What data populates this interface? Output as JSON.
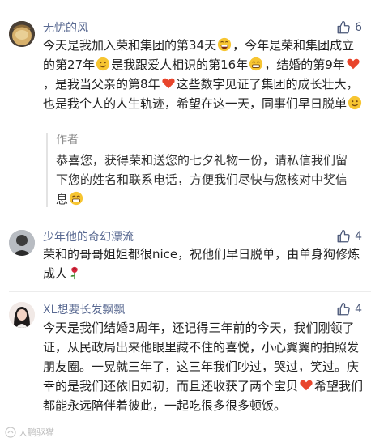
{
  "comments": [
    {
      "username": "无忧的风",
      "likes": "6",
      "text_parts": [
        "今天是我加入荣和集团的第34天",
        "，今年是荣和集团成立的第27年",
        "是我跟爱人相识的第16年",
        "，结婚的第9年",
        "，是我当父亲的第8年",
        "这些数字见证了集团的成长壮大，也是我个人的人生轨迹，希望在这一天，同事们早日脱单"
      ],
      "reply": {
        "author": "作者",
        "text": "恭喜您，获得荣和送您的七夕礼物一份，请私信我们留下您的姓名和联系电话，方便我们尽快与您核对中奖信息"
      }
    },
    {
      "username": "少年他的奇幻漂流",
      "likes": "4",
      "text": "荣和的哥哥姐姐都很nice，祝他们早日脱单，由单身狗修炼成人"
    },
    {
      "username": "XL想要长发飘飘",
      "likes": "4",
      "text_parts": [
        "今天是我们结婚3周年，还记得三年前的今天，我们刚领了证，从民政局出来他眼里藏不住的喜悦，小心翼翼的拍照发朋友圈。一晃就三年了，这三年我们吵过，哭过，笑过。庆幸的是我们还依旧如初，而且还收获了两个宝贝",
        "希望我们都能永远陪伴着彼此，一起吃很多很多顿饭。"
      ]
    }
  ],
  "watermark": "大鹏驱猫",
  "colors": {
    "username": "#5a6a92",
    "heart": "#e8452c",
    "emoji_face": "#f7c531",
    "like_icon": "#4a5778"
  },
  "icons": [
    "thumbs-up-icon",
    "smile-emoji",
    "grin-emoji",
    "heart-icon",
    "rose-icon"
  ]
}
